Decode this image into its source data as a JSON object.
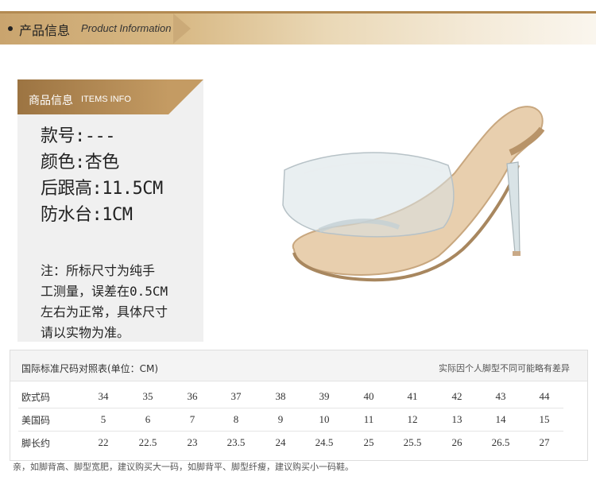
{
  "top_banner": {
    "title_cn": "产品信息",
    "title_en": "Product Information"
  },
  "info_panel": {
    "header_cn": "商品信息",
    "header_en": "ITEMS INFO",
    "specs": [
      "款号:---",
      "颜色:杏色",
      "后跟高:11.5CM",
      "防水台:1CM"
    ],
    "note": "注：所标尺寸为纯手\n工测量，误差在0.5CM\n左右为正常，具体尺寸\n请以实物为准。"
  },
  "product_image": {
    "description_icon": "clear-strap-stiletto-mule"
  },
  "size_table": {
    "title": "国际标准尺码对照表(单位：CM)",
    "subtitle": "实际因个人脚型不同可能略有差异",
    "rows": [
      {
        "label": "欧式码",
        "values": [
          "34",
          "35",
          "36",
          "37",
          "38",
          "39",
          "40",
          "41",
          "42",
          "43",
          "44"
        ]
      },
      {
        "label": "美国码",
        "values": [
          "5",
          "6",
          "7",
          "8",
          "9",
          "10",
          "11",
          "12",
          "13",
          "14",
          "15"
        ]
      },
      {
        "label": "脚长约",
        "values": [
          "22",
          "22.5",
          "23",
          "23.5",
          "24",
          "24.5",
          "25",
          "25.5",
          "26",
          "26.5",
          "27"
        ]
      }
    ]
  },
  "footnote": "亲，如脚背高、脚型宽肥，建议购买大一码，如脚背平、脚型纤瘦，建议购买小一码鞋。",
  "colors": {
    "gold_dark": "#9c7442",
    "gold_light": "#d8b985",
    "panel_bg": "#f0f0f0"
  }
}
